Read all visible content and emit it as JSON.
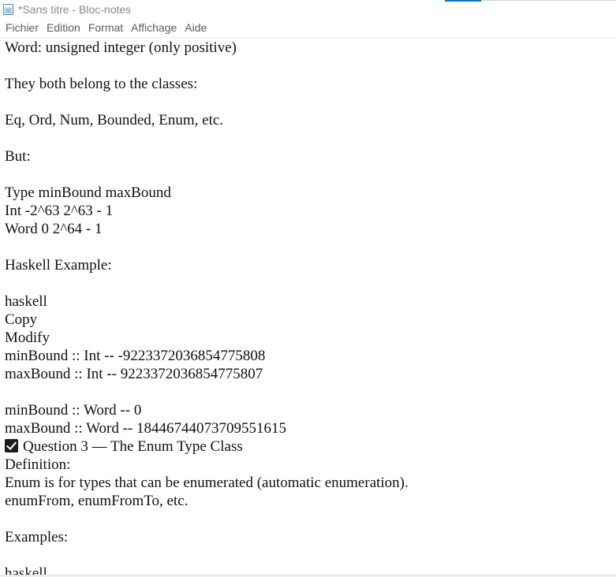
{
  "window": {
    "title": "*Sans titre - Bloc-notes",
    "icon": "notepad-icon"
  },
  "menu": [
    "Fichier",
    "Edition",
    "Format",
    "Affichage",
    "Aide"
  ],
  "editor": {
    "lines": [
      "Word: unsigned integer (only positive)",
      "",
      "They both belong to the classes:",
      "",
      "Eq, Ord, Num, Bounded, Enum, etc.",
      "",
      "But:",
      "",
      "Type minBound maxBound",
      "Int -2^63 2^63 - 1",
      "Word 0 2^64 - 1",
      "",
      "Haskell Example:",
      "",
      "haskell",
      "Copy",
      "Modify",
      "minBound :: Int -- -9223372036854775808",
      "maxBound :: Int -- 9223372036854775807",
      "",
      "minBound :: Word -- 0",
      "maxBound :: Word -- 18446744073709551615",
      "Question 3 — The Enum Type Class",
      "Definition:",
      "Enum is for types that can be enumerated (automatic enumeration).",
      "enumFrom, enumFromTo, etc.",
      "",
      "Examples:",
      "",
      "haskell"
    ],
    "checkbox_line_index": 22,
    "checkbox_icon": "check-box-icon"
  },
  "colors": {
    "title_text": "#8a8a8a",
    "menu_text": "#5c5c5c",
    "accent": "#0078d7",
    "text": "#111111"
  }
}
